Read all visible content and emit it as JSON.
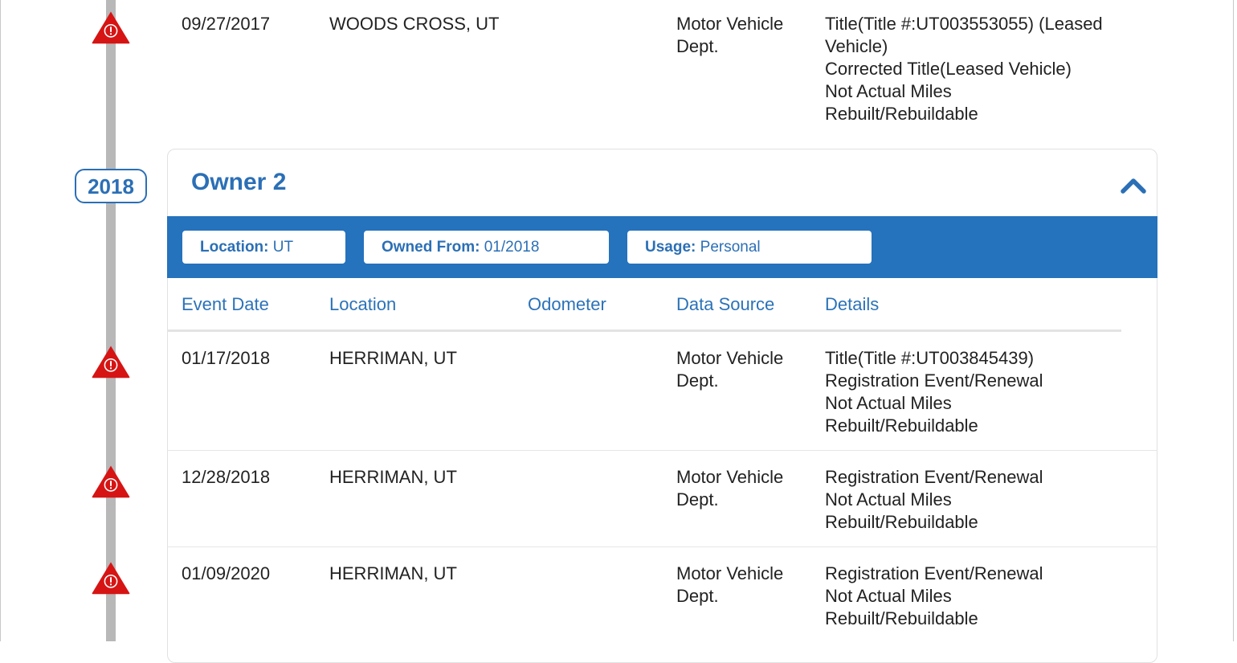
{
  "owner": {
    "title": "Owner 2",
    "year": "2018",
    "location_label": "Location:",
    "location_value": "UT",
    "owned_from_label": "Owned From:",
    "owned_from_value": "01/2018",
    "usage_label": "Usage:",
    "usage_value": "Personal"
  },
  "table": {
    "headers": [
      "Event Date",
      "Location",
      "Odometer",
      "Data Source",
      "Details"
    ]
  },
  "prev_record": {
    "date": "09/27/2017",
    "location": "WOODS CROSS, UT",
    "source": [
      "Motor Vehicle",
      "Dept."
    ],
    "details": [
      "Title(Title #:UT003553055) (Leased",
      "Vehicle)",
      "Corrected Title(Leased Vehicle)",
      "Not Actual Miles",
      "Rebuilt/Rebuildable"
    ]
  },
  "records": [
    {
      "date": "01/17/2018",
      "location": "HERRIMAN, UT",
      "source": [
        "Motor Vehicle",
        "Dept."
      ],
      "details": [
        "Title(Title #:UT003845439)",
        "Registration Event/Renewal",
        "Not Actual Miles",
        "Rebuilt/Rebuildable"
      ]
    },
    {
      "date": "12/28/2018",
      "location": "HERRIMAN, UT",
      "source": [
        "Motor Vehicle",
        "Dept."
      ],
      "details": [
        "Registration Event/Renewal",
        "Not Actual Miles",
        "Rebuilt/Rebuildable"
      ]
    },
    {
      "date": "01/09/2020",
      "location": "HERRIMAN, UT",
      "source": [
        "Motor Vehicle",
        "Dept."
      ],
      "details": [
        "Registration Event/Renewal",
        "Not Actual Miles",
        "Rebuilt/Rebuildable"
      ]
    }
  ],
  "icons": {
    "alert": "alert-triangle-icon",
    "collapse": "chevron-up-icon"
  },
  "colors": {
    "accent": "#2572bd",
    "alert": "#d61414",
    "timeline": "#b8b8b8"
  }
}
